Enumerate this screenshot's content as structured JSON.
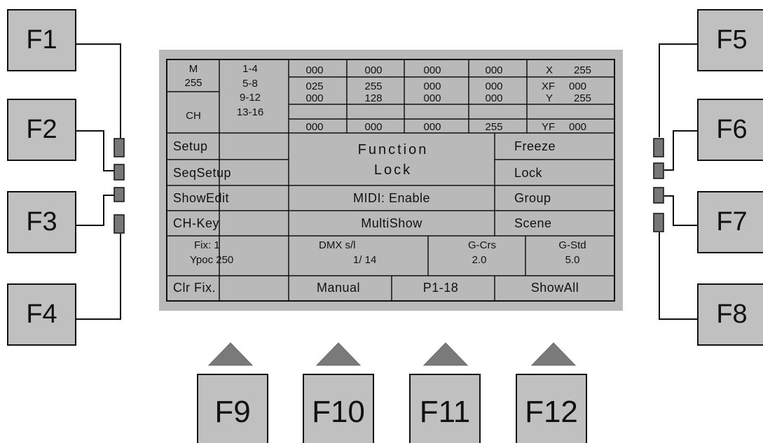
{
  "function_keys": {
    "left": [
      "F1",
      "F2",
      "F3",
      "F4"
    ],
    "right": [
      "F5",
      "F6",
      "F7",
      "F8"
    ],
    "bottom": [
      "F9",
      "F10",
      "F11",
      "F12"
    ]
  },
  "display": {
    "m_label": "M",
    "m_value": "255",
    "ch_label": "CH",
    "ranges": [
      "1-4",
      "5-8",
      "9-12",
      "13-16"
    ],
    "channel_rows": [
      [
        "000",
        "000",
        "000",
        "000"
      ],
      [
        "025",
        "255",
        "000",
        "000"
      ],
      [
        "000",
        "128",
        "000",
        "000"
      ],
      [
        "000",
        "000",
        "000",
        "255"
      ]
    ],
    "xy": [
      {
        "label": "X",
        "value": "255"
      },
      {
        "label": "XF",
        "value": "000"
      },
      {
        "label": "Y",
        "value": "255"
      },
      {
        "label": "YF",
        "value": "000"
      }
    ],
    "left_menu": [
      "Setup",
      "SeqSetup",
      "ShowEdit",
      "CH-Key"
    ],
    "right_menu": [
      "Freeze",
      "Lock",
      "Group",
      "Scene"
    ],
    "function_title_1": "Function",
    "function_title_2": "Lock",
    "midi": "MIDI: Enable",
    "multishow": "MultiShow",
    "fix_line_1": "Fix: 1",
    "fix_line_2": "Ypoc 250",
    "dmx_line_1": "DMX s/l",
    "dmx_line_2": "1/ 14",
    "gcrs_label": "G-Crs",
    "gcrs_value": "2.0",
    "gstd_label": "G-Std",
    "gstd_value": "5.0",
    "bottom_menu": [
      "Clr Fix.",
      "Manual",
      "P1-18",
      "ShowAll"
    ]
  }
}
